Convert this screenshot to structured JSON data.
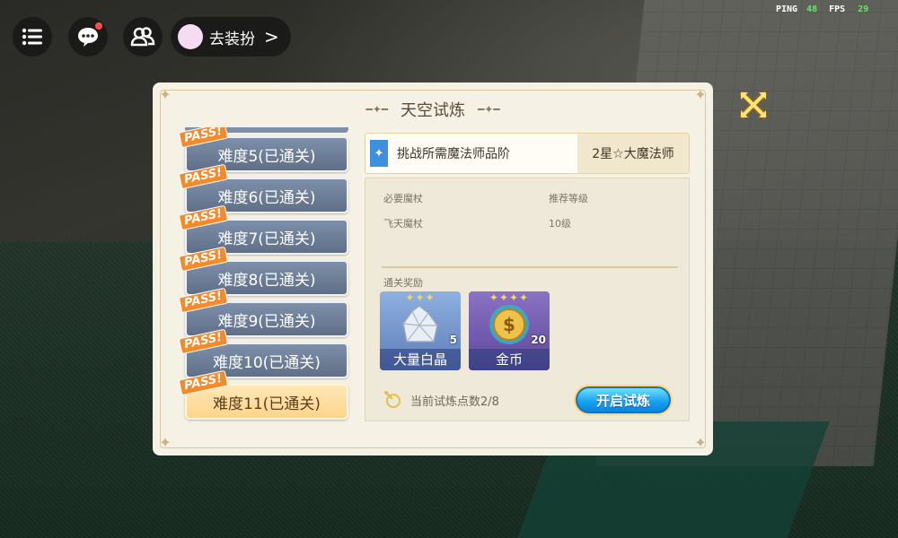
{
  "hud": {
    "dress_up_label": "去装扮",
    "dress_up_arrow": ">",
    "ping_label": "PING",
    "ping_value": "48",
    "fps_label": "FPS",
    "fps_value": "29"
  },
  "panel": {
    "title": "天空试炼",
    "difficulties": [
      {
        "label": "难度5(已通关)",
        "passed": true,
        "selected": false
      },
      {
        "label": "难度6(已通关)",
        "passed": true,
        "selected": false
      },
      {
        "label": "难度7(已通关)",
        "passed": true,
        "selected": false
      },
      {
        "label": "难度8(已通关)",
        "passed": true,
        "selected": false
      },
      {
        "label": "难度9(已通关)",
        "passed": true,
        "selected": false
      },
      {
        "label": "难度10(已通关)",
        "passed": true,
        "selected": false
      },
      {
        "label": "难度11(已通关)",
        "passed": true,
        "selected": true
      }
    ],
    "pass_badge": "PASS!",
    "requirement": {
      "label": "挑战所需魔法师品阶",
      "value": "2星☆大魔法师"
    },
    "info": {
      "wand_header": "必要魔杖",
      "wand_value": "飞天魔杖",
      "level_header": "推荐等级",
      "level_value": "10级"
    },
    "rewards_header": "通关奖励",
    "rewards": [
      {
        "name": "大量白晶",
        "count": "5",
        "stars": "✦✦✦",
        "color": "#6f8fc9"
      },
      {
        "name": "金币",
        "count": "20",
        "stars": "✦✦✦✦",
        "color": "#6f5aa8"
      }
    ],
    "points_text": "当前试炼点数2/8",
    "start_button": "开启试炼"
  },
  "colors": {
    "accent_blue": "#1aa3f2",
    "selected_gold": "#ffd48a",
    "pass_orange": "#f58a2b"
  }
}
